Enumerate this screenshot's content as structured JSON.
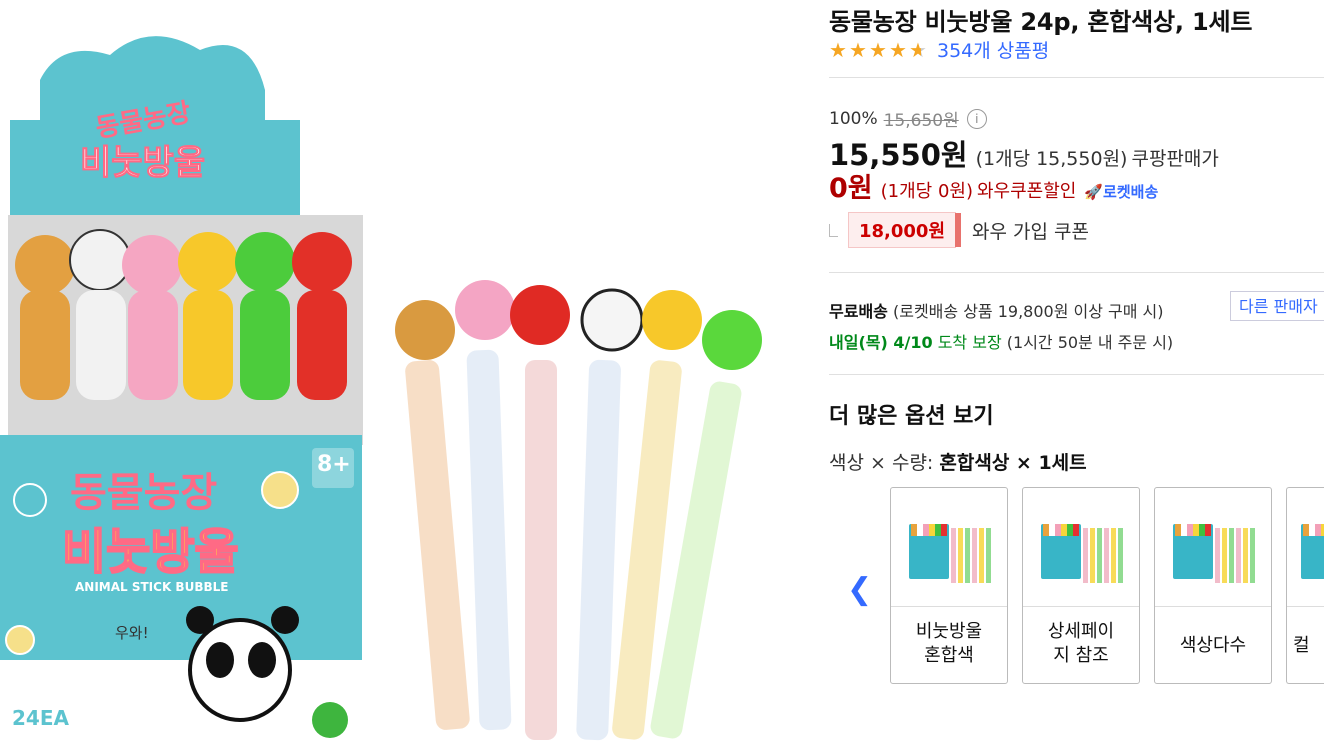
{
  "product": {
    "title": "동물농장 비눗방울 24p, 혼합색상, 1세트",
    "rating": 4.5,
    "review_count": "354개 상품평"
  },
  "pricing": {
    "discount_rate": "100%",
    "original_price": "15,650원",
    "sale_price": "15,550원",
    "sale_unit": "(1개당 15,550원)",
    "sale_label": "쿠팡판매가",
    "coupon_price": "0원",
    "coupon_unit": "(1개당 0원)",
    "coupon_label": "와우쿠폰할인",
    "rocket_label": "로켓배송",
    "wow_coupon_amount": "18,000원",
    "wow_coupon_label": "와우 가입 쿠폰"
  },
  "shipping": {
    "free_label": "무료배송",
    "free_detail": "(로켓배송 상품 19,800원 이상 구매 시)",
    "other_seller_button": "다른 판매자",
    "arrival_day": "내일(목) 4/10",
    "arrival_text": "도착 보장",
    "arrival_detail": "(1시간 50분 내 주문 시)"
  },
  "options": {
    "heading": "더 많은 옵션 보기",
    "selector_prefix": "색상 × 수량:",
    "selected_value": "혼합색상 × 1세트",
    "cards": [
      {
        "label_line1": "비눗방울",
        "label_line2": "혼합색"
      },
      {
        "label_line1": "상세페이",
        "label_line2": "지 참조"
      },
      {
        "label_line1": "색상다수",
        "label_line2": ""
      },
      {
        "label_line1": "컬",
        "label_line2": ""
      }
    ]
  },
  "product_image": {
    "box_title_top": "동물농장",
    "box_title_bottom": "비눗방울",
    "box_subtitle": "ANIMAL STICK BUBBLE",
    "box_count": "24EA",
    "age_badge": "8+",
    "speech": "우와!"
  },
  "colors": {
    "accent_blue": "#346aff",
    "coupon_red": "#ae0000",
    "arrival_green": "#00891a",
    "star": "#f5a623"
  }
}
